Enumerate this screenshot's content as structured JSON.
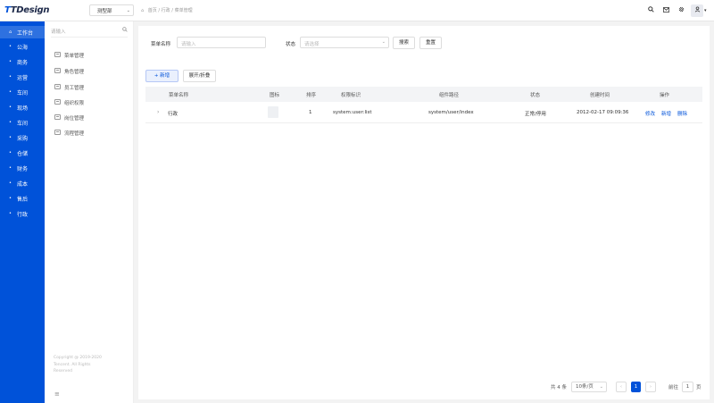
{
  "app": {
    "logo_mark": "T",
    "logo_text": "TDesign"
  },
  "header": {
    "department": "测型部",
    "breadcrumb": [
      "首页",
      "行政",
      "菜单管理"
    ],
    "icons": [
      "search-icon",
      "mail-icon",
      "gear-icon",
      "user-icon"
    ]
  },
  "nav": {
    "items": [
      {
        "label": "工作台",
        "active": true
      },
      {
        "label": "公海"
      },
      {
        "label": "商务"
      },
      {
        "label": "运营"
      },
      {
        "label": "车间"
      },
      {
        "label": "现场"
      },
      {
        "label": "车间"
      },
      {
        "label": "采购"
      },
      {
        "label": "仓储"
      },
      {
        "label": "财务"
      },
      {
        "label": "成本"
      },
      {
        "label": "售后"
      },
      {
        "label": "行政"
      }
    ]
  },
  "submenu": {
    "search_placeholder": "请输入",
    "items": [
      {
        "label": "菜单管理"
      },
      {
        "label": "角色管理"
      },
      {
        "label": "员工管理"
      },
      {
        "label": "组织权限"
      },
      {
        "label": "岗位管理"
      },
      {
        "label": "流程管理"
      }
    ],
    "copyright": [
      "Copyright @ 2019-2020",
      "Tencent. All Rights",
      "Reserved"
    ],
    "collapse_icon": "≡"
  },
  "filters": {
    "name_label": "菜单名称",
    "name_placeholder": "请输入",
    "status_label": "状态",
    "status_placeholder": "请选择",
    "search_button": "搜索",
    "reset_button": "重置"
  },
  "toolbar": {
    "add_button": "+ 新增",
    "expand_button": "展开/折叠"
  },
  "table": {
    "columns": [
      "菜单名称",
      "图标",
      "排序",
      "权限标识",
      "组件路径",
      "状态",
      "创建时间",
      "操作"
    ],
    "rows": [
      {
        "name": "行政",
        "order": "1",
        "permission": "system:user:list",
        "component": "system/user/index",
        "status": "正常/停用",
        "created": "2012-02-17  09:09:36",
        "actions": [
          "修改",
          "新增",
          "删除"
        ]
      }
    ]
  },
  "pagination": {
    "total_text": "共 4 条",
    "page_size": "10条/页",
    "current_page": "1",
    "goto_label": "前往",
    "goto_value": "1",
    "goto_suffix": "页"
  }
}
